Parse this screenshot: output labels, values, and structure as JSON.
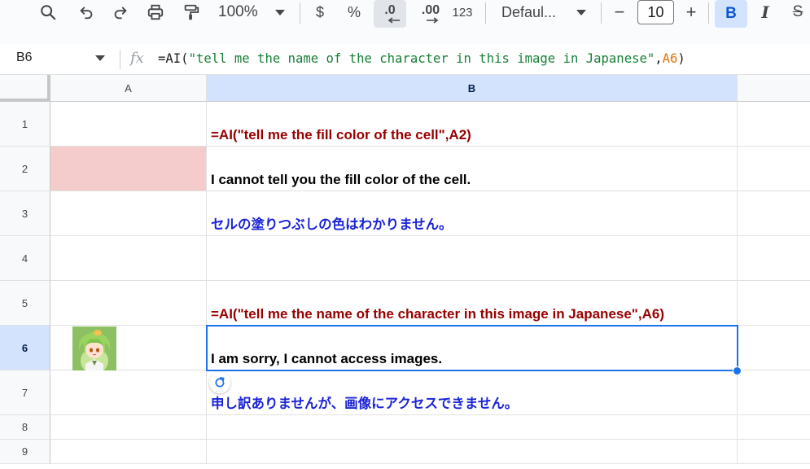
{
  "toolbar": {
    "zoom": "100%",
    "currency_label": "$",
    "percent_label": "%",
    "decrease_decimal_label": ".0",
    "increase_decimal_label": ".00",
    "number_format_label": "123",
    "font_family": "Defaul...",
    "font_size": "10",
    "minus_label": "−",
    "plus_label": "+",
    "bold_label": "B",
    "italic_label": "I",
    "strike_label": "S",
    "bold_active": true
  },
  "formula_bar": {
    "name_box": "B6",
    "fx_label": "fx",
    "formula_prefix": "=AI(",
    "formula_string": "\"tell me the name of the character in this image in Japanese\"",
    "formula_comma": ",",
    "formula_ref": "A6",
    "formula_suffix": ")"
  },
  "columns": [
    {
      "label": "A"
    },
    {
      "label": "B"
    }
  ],
  "selected_cell": "B6",
  "rows": [
    {
      "label": "1"
    },
    {
      "label": "2"
    },
    {
      "label": "3"
    },
    {
      "label": "4"
    },
    {
      "label": "5"
    },
    {
      "label": "6"
    },
    {
      "label": "7"
    },
    {
      "label": "8"
    },
    {
      "label": "9"
    }
  ],
  "cells": {
    "A2": {
      "fill_color": "#f4cccc"
    },
    "A6": {
      "image": "character-image"
    },
    "B1": {
      "text": "=AI(\"tell me the fill color of the cell\",A2)"
    },
    "B2": {
      "text": "I cannot tell you the fill color of the cell."
    },
    "B3": {
      "text": "セルの塗りつぶしの色はわかりません。"
    },
    "B5": {
      "text": "=AI(\"tell me the name of the character in this image in Japanese\",A6)"
    },
    "B6": {
      "text": "I am sorry, I cannot access images."
    },
    "B7": {
      "text": "申し訳ありませんが、画像にアクセスできません。"
    }
  },
  "colors": {
    "formula_text": "#980000",
    "answer_english": "#000000",
    "answer_japanese": "#1a24d6",
    "selection": "#1a73e8",
    "header_selected": "#d3e3fd"
  }
}
